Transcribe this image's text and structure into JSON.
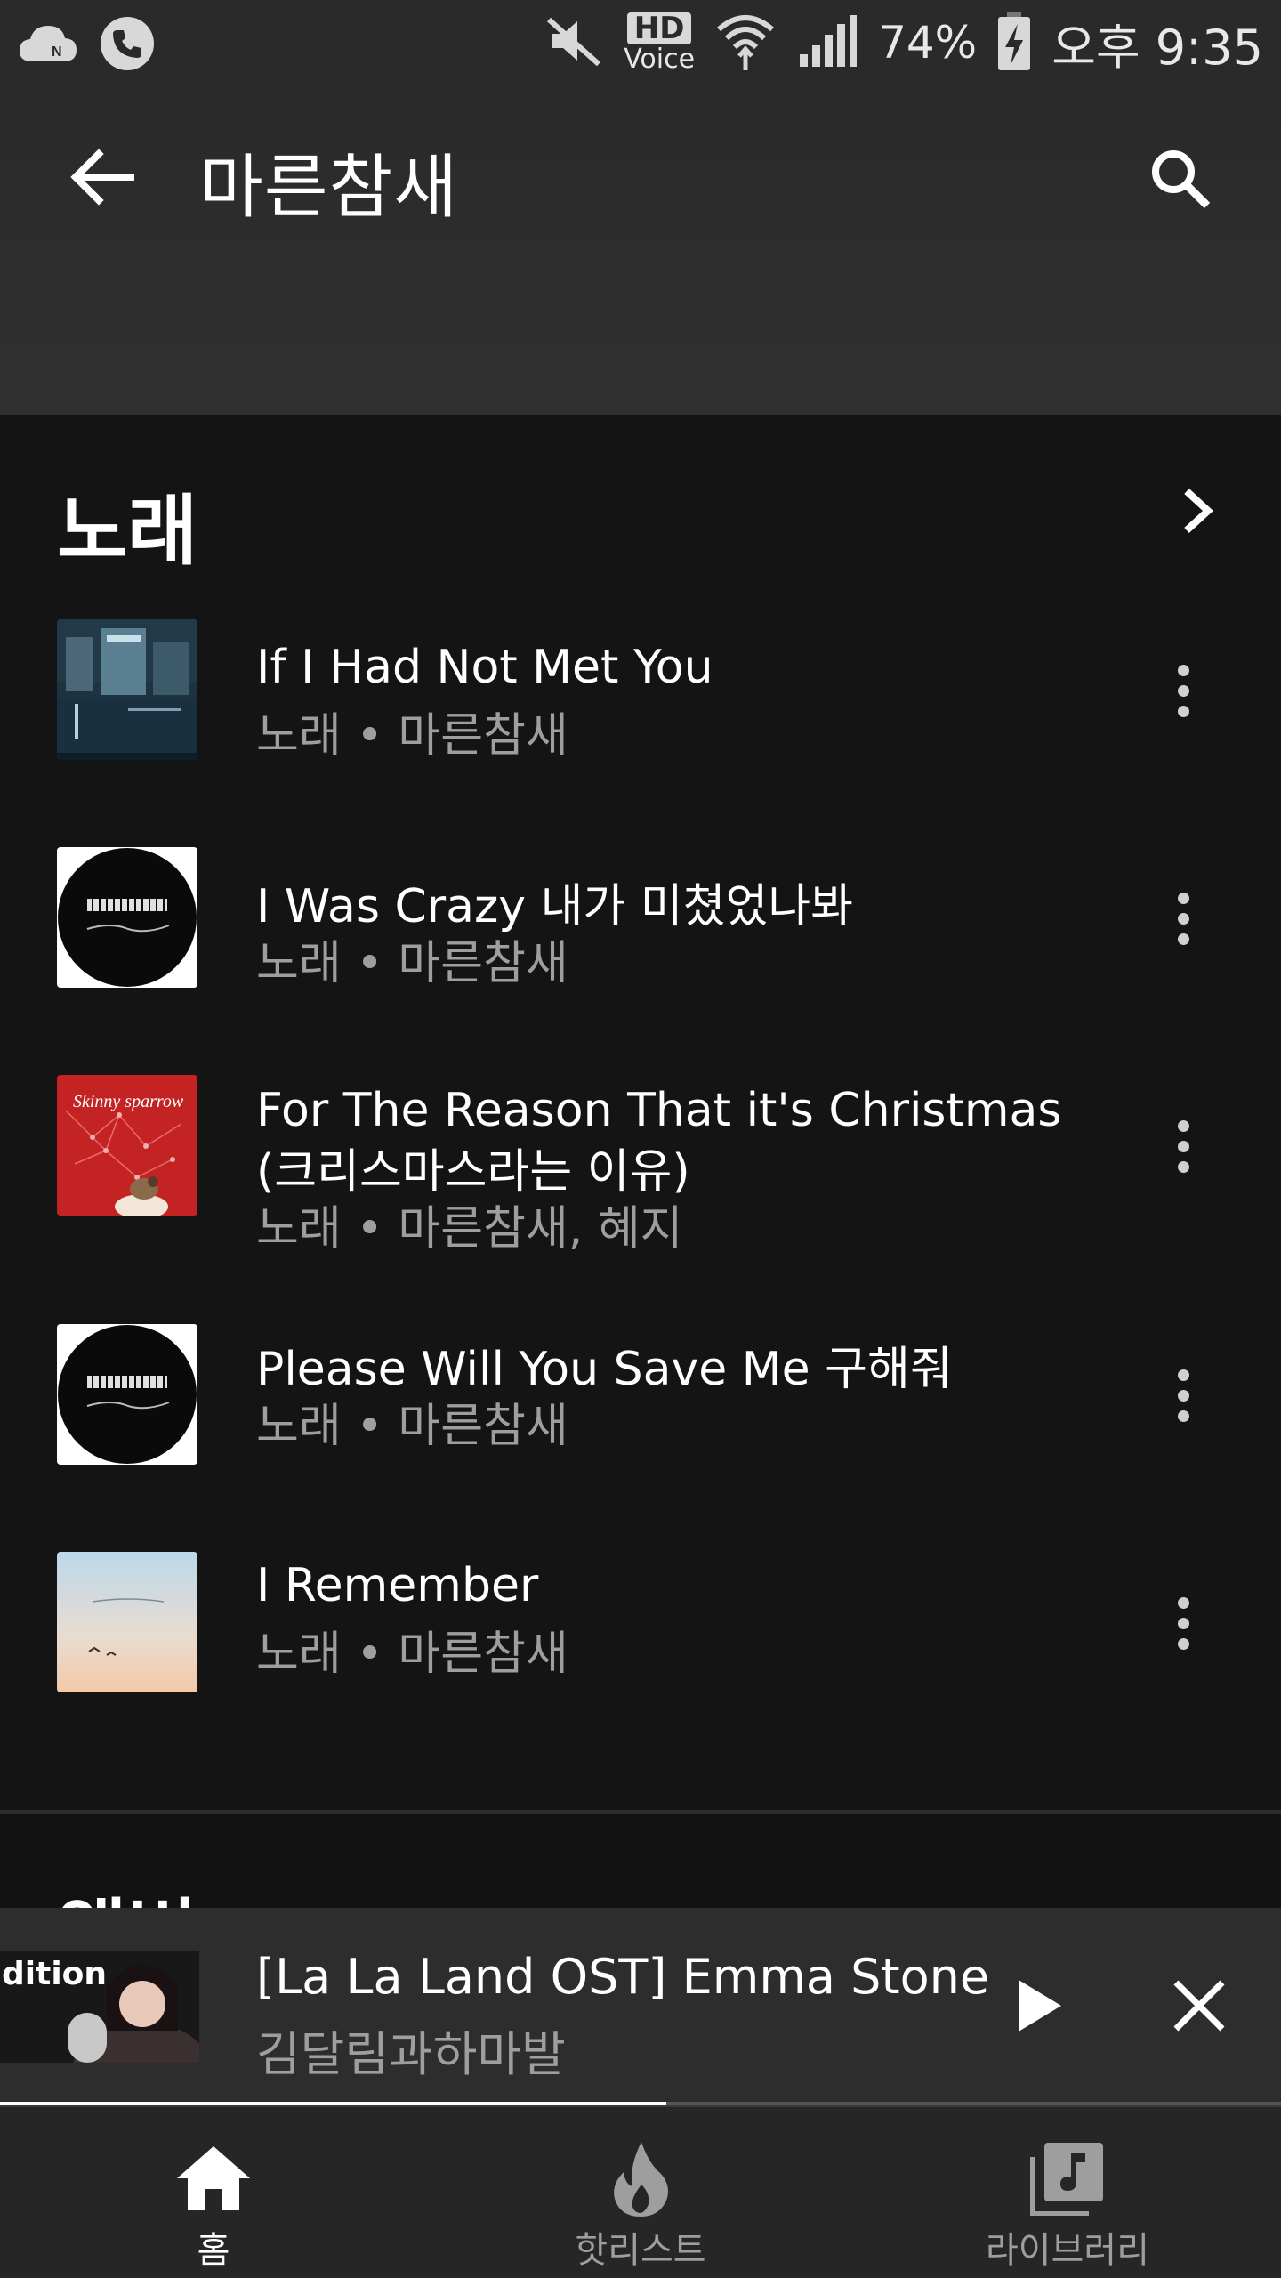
{
  "status_bar": {
    "battery": "74%",
    "time": "오후 9:35",
    "hd": "HD",
    "voice": "Voice",
    "icons": [
      "cloud-icon",
      "phone-icon",
      "mute-icon",
      "wifi-icon",
      "signal-icon",
      "battery-charging-icon"
    ]
  },
  "app_bar": {
    "title": "마른참새",
    "back_icon": "arrow-back-icon",
    "search_icon": "search-icon"
  },
  "songs_section": {
    "heading": "노래",
    "more_icon": "chevron-right-icon",
    "items": [
      {
        "title": "If I Had Not Met You",
        "subtitle": "노래 • 마른참새",
        "art": "city-night"
      },
      {
        "title": "I Was Crazy 내가 미쳤었나봐",
        "subtitle": "노래 • 마른참새",
        "art": "black-circle"
      },
      {
        "title_line1": "For The Reason That it's Christmas",
        "title_line2": "(크리스마스라는 이유)",
        "subtitle": "노래 • 마른참새, 혜지",
        "art": "red-sparrow"
      },
      {
        "title": "Please Will You Save Me 구해줘",
        "subtitle": "노래 • 마른참새",
        "art": "black-circle"
      },
      {
        "title": "I Remember",
        "subtitle": "노래 • 마른참새",
        "art": "sky-gradient"
      }
    ]
  },
  "next_section": {
    "heading_partial": "앨범"
  },
  "mini_player": {
    "title": "[La La Land OST] Emma Stone",
    "artist": "김달림과하마발",
    "thumb_text": "dition",
    "progress": 0.52
  },
  "bottom_nav": {
    "items": [
      {
        "label": "홈",
        "icon": "home-icon",
        "active": true
      },
      {
        "label": "핫리스트",
        "icon": "flame-icon",
        "active": false
      },
      {
        "label": "라이브러리",
        "icon": "library-music-icon",
        "active": false
      }
    ]
  },
  "colors": {
    "background": "#141414",
    "appbar": "#2a2a2a",
    "text_primary": "#ffffff",
    "text_secondary": "#9e9e9e"
  }
}
